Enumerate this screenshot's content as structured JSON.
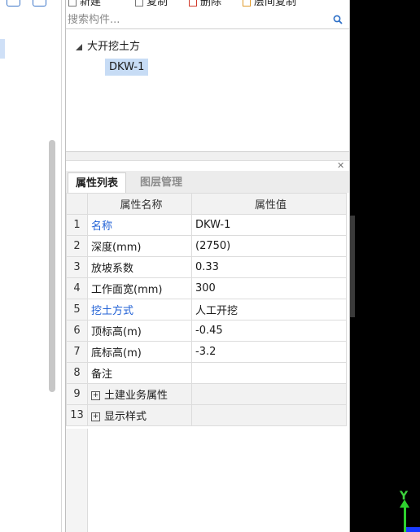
{
  "toolbar": {
    "new_label": "新建",
    "copy_label": "复制",
    "delete_label": "删除",
    "layer_copy_label": "层间复制"
  },
  "search": {
    "placeholder": "搜索构件..."
  },
  "tree": {
    "root_label": "大开挖土方",
    "child_label": "DKW-1"
  },
  "tabs": [
    {
      "label": "属性列表",
      "active": true
    },
    {
      "label": "图层管理",
      "active": false
    }
  ],
  "table": {
    "headers": [
      "属性名称",
      "属性值"
    ],
    "rows": [
      {
        "num": "1",
        "name": "名称",
        "value": "DKW-1",
        "blue": true
      },
      {
        "num": "2",
        "name": "深度(mm)",
        "value": "(2750)",
        "blue": false
      },
      {
        "num": "3",
        "name": "放坡系数",
        "value": "0.33",
        "blue": false
      },
      {
        "num": "4",
        "name": "工作面宽(mm)",
        "value": "300",
        "blue": false
      },
      {
        "num": "5",
        "name": "挖土方式",
        "value": "人工开挖",
        "blue": true
      },
      {
        "num": "6",
        "name": "顶标高(m)",
        "value": "-0.45",
        "blue": false
      },
      {
        "num": "7",
        "name": "底标高(m)",
        "value": "-3.2",
        "blue": false
      },
      {
        "num": "8",
        "name": "备注",
        "value": "",
        "blue": false
      },
      {
        "num": "9",
        "name": "土建业务属性",
        "value": "",
        "blue": false,
        "group": true
      },
      {
        "num": "13",
        "name": "显示样式",
        "value": "",
        "blue": false,
        "group": true
      }
    ]
  },
  "axis": {
    "y_label": "Y"
  },
  "colors": {
    "blue_text": "#2161d6",
    "selection": "#c7dcf5",
    "axis_green": "#2ed12e",
    "axis_blue": "#1a3cff"
  }
}
